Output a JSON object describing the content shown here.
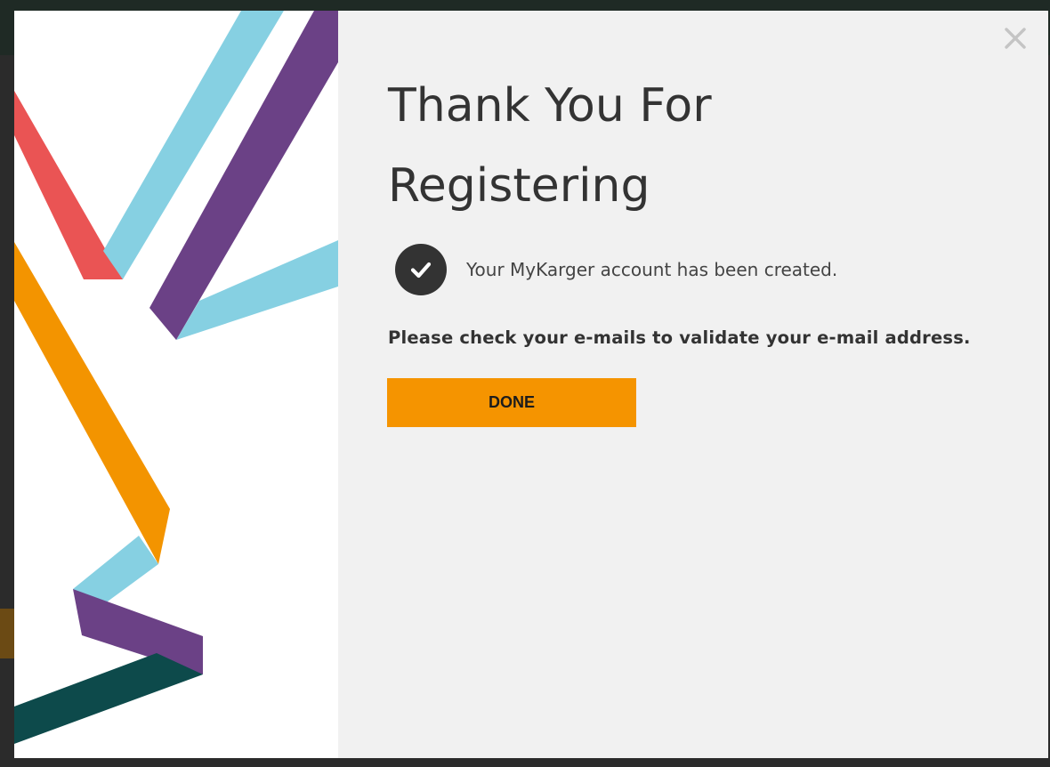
{
  "dialog": {
    "title_line1": "Thank You For",
    "title_line2": "Registering",
    "confirmation_text": "Your MyKarger account has been created.",
    "instruction_text": "Please check your e-mails to validate your e-mail address.",
    "done_label": "DONE",
    "close_icon": "close-icon",
    "check_icon": "check-circle-icon"
  },
  "colors": {
    "accent": "#f59400",
    "panel_background": "#f1f1f1",
    "ribbon_red": "#ea5454",
    "ribbon_light_blue": "#86d0e2",
    "ribbon_purple": "#6b4186",
    "ribbon_orange": "#f39400",
    "ribbon_dark_teal": "#0d4a4b"
  }
}
